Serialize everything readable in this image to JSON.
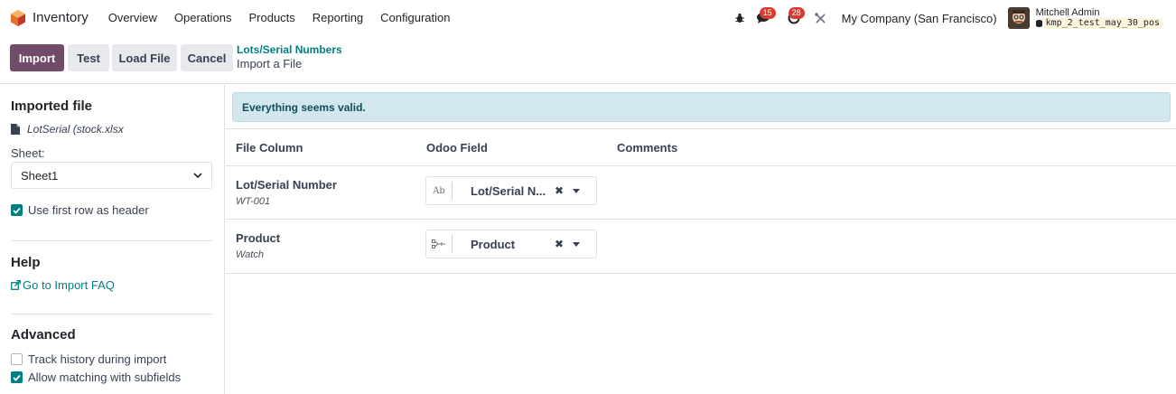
{
  "navbar": {
    "app_name": "Inventory",
    "menu": [
      "Overview",
      "Operations",
      "Products",
      "Reporting",
      "Configuration"
    ],
    "messages_count": "15",
    "activities_count": "28",
    "company": "My Company (San Francisco)",
    "user_name": "Mitchell Admin",
    "database": "kmp_2_test_may_30_pos"
  },
  "control": {
    "import_label": "Import",
    "test_label": "Test",
    "load_file_label": "Load File",
    "cancel_label": "Cancel",
    "breadcrumb_parent": "Lots/Serial Numbers",
    "breadcrumb_current": "Import a File"
  },
  "sidebar": {
    "imported_file_title": "Imported file",
    "file_name": "LotSerial (stock.xlsx",
    "sheet_label": "Sheet:",
    "sheet_value": "Sheet1",
    "use_header_label": "Use first row as header",
    "use_header_checked": true,
    "help_title": "Help",
    "faq_label": "Go to Import FAQ",
    "advanced_title": "Advanced",
    "track_history_label": "Track history during import",
    "track_history_checked": false,
    "allow_matching_label": "Allow matching with subfields",
    "allow_matching_checked": true
  },
  "main": {
    "alert": "Everything seems valid.",
    "headers": {
      "file_column": "File Column",
      "odoo_field": "Odoo Field",
      "comments": "Comments"
    },
    "rows": [
      {
        "name": "Lot/Serial Number",
        "sample": "WT-001",
        "field": "Lot/Serial N...",
        "field_icon": "text-field-icon"
      },
      {
        "name": "Product",
        "sample": "Watch",
        "field": "Product",
        "field_icon": "relation-field-icon"
      }
    ]
  },
  "colors": {
    "primary": "#714b67",
    "link": "#017e84",
    "alert_bg": "#d2e8ee",
    "badge": "#d73b2f"
  }
}
